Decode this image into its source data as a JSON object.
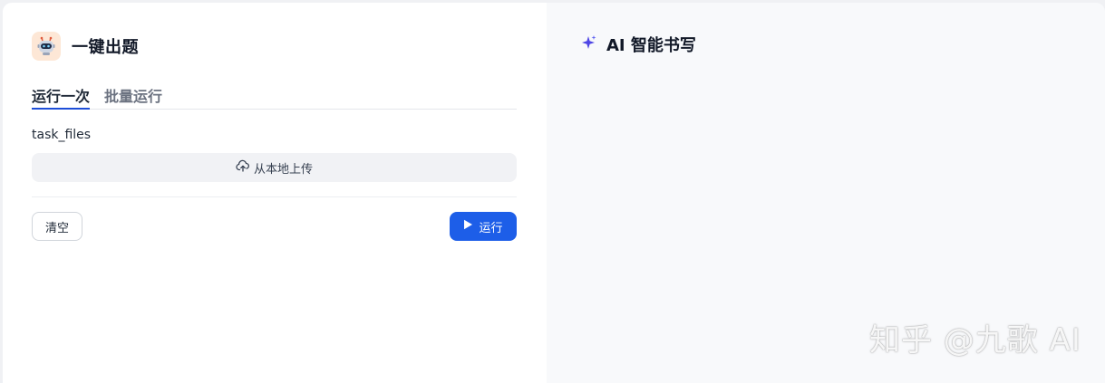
{
  "app": {
    "title": "一键出题",
    "icon": "robot-icon"
  },
  "tabs": [
    {
      "label": "运行一次",
      "active": true
    },
    {
      "label": "批量运行",
      "active": false
    }
  ],
  "form": {
    "field_label": "task_files",
    "upload_label": "从本地上传",
    "upload_icon": "cloud-upload-icon"
  },
  "actions": {
    "clear_label": "清空",
    "run_label": "运行",
    "run_icon": "play-icon"
  },
  "output": {
    "title": "AI 智能书写",
    "icon": "sparkle-icon"
  },
  "watermark": "知乎 @九歌 AI",
  "colors": {
    "accent": "#1d5ee8",
    "tab_underline": "#1d4ed8",
    "sparkle": "#4f46e5",
    "avatar_bg": "#fde7d6"
  }
}
